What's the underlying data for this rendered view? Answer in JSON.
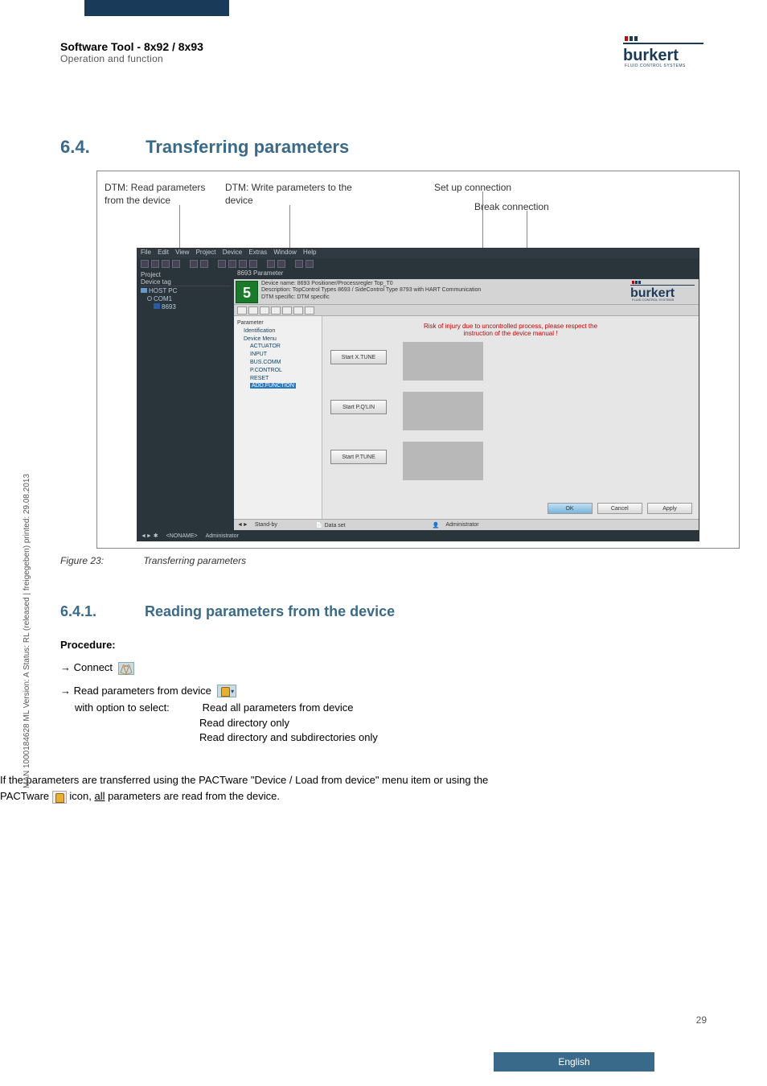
{
  "header": {
    "title": "Software Tool - 8x92 / 8x93",
    "subtitle": "Operation and function"
  },
  "logo": {
    "name": "burkert",
    "tag": "FLUID CONTROL SYSTEMS"
  },
  "section": {
    "num": "6.4.",
    "title": "Transferring parameters"
  },
  "annotations": {
    "a1": "DTM: Read parameters from the device",
    "a2": "DTM: Write parameters to the device",
    "a3": "Set up connection",
    "a4": "Break connection"
  },
  "app": {
    "menu": {
      "file": "File",
      "edit": "Edit",
      "view": "View",
      "project": "Project",
      "device": "Device",
      "extras": "Extras",
      "window": "Window",
      "help": "Help"
    },
    "project": {
      "header": "Project",
      "col": "Device tag",
      "host": "HOST PC",
      "com": "COM1",
      "dev": "8693"
    },
    "tab": "8693 Parameter",
    "info": {
      "dname_lbl": "Device name:",
      "dname": "8693 Positioner/Processregler Top_T0",
      "desc_lbl": "Description:",
      "desc": "TopControl Types 8693 / SideControl Type 8793 with HART Communication",
      "dtm_lbl": "DTM specific:",
      "dtm": "DTM specific"
    },
    "tree": {
      "root": "Parameter",
      "ident": "Identification",
      "devmenu": "Device Menu",
      "act": "ACTUATOR",
      "inp": "INPUT",
      "bus": "BUS.COMM",
      "pcon": "P.CONTROL",
      "reset": "RESET",
      "add": "ADD.FUNCTION"
    },
    "right": {
      "warn1": "Risk of injury due to uncontrolled process, please respect the",
      "warn2": "instruction of the device manual !",
      "b1": "Start X.TUNE",
      "b2": "Start P.Q'LIN",
      "b3": "Start P.TUNE"
    },
    "dlg": {
      "ok": "OK",
      "cancel": "Cancel",
      "apply": "Apply"
    },
    "status": {
      "s1": "Stand-by",
      "s2": "Data set",
      "s3": "Administrator"
    },
    "footer": {
      "f1": "<NONAME>",
      "f2": "Administrator"
    }
  },
  "figcap": {
    "lbl": "Figure 23:",
    "txt": "Transferring parameters"
  },
  "subsection": {
    "num": "6.4.1.",
    "title": "Reading parameters from the device"
  },
  "procedure": {
    "hd": "Procedure:",
    "s1": "Connect",
    "s2": "Read parameters from device",
    "opt_lbl": "with option to select:",
    "o1": "Read all parameters from device",
    "o2": "Read directory only",
    "o3": "Read directory and subdirectories only"
  },
  "note": {
    "l1a": "If the parameters are transferred using the PACTware \"Device / Load from device\" menu item or using the",
    "l1b": "PACTware ",
    "l1c": " icon, ",
    "l1d": "all",
    "l1e": " parameters are read from the device."
  },
  "side": "MAN 1000184628 ML Version: A Status: RL (released | freigegeben) printed: 29.08.2013",
  "pagenum": "29",
  "lang": "English"
}
